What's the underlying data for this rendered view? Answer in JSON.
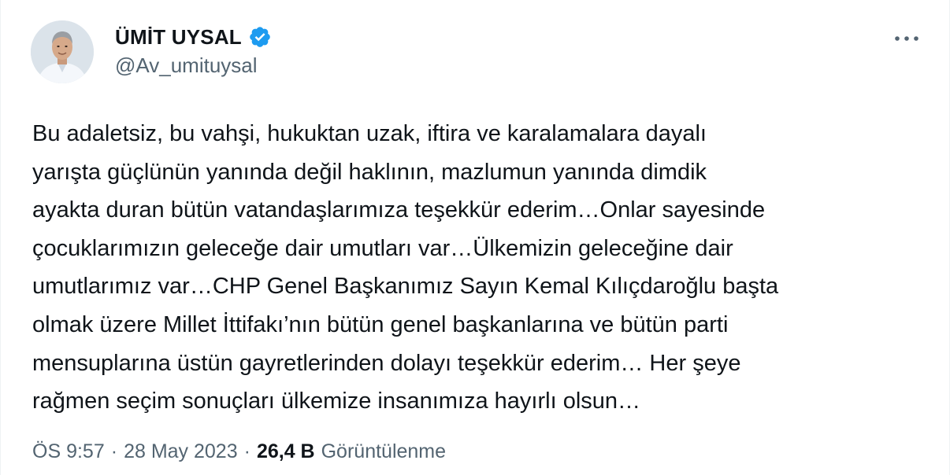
{
  "author": {
    "display_name": "ÜMİT UYSAL",
    "handle": "@Av_umituysal",
    "verified": true,
    "verified_icon": "verified-badge-icon",
    "verified_color": "#1d9bf0"
  },
  "tweet": {
    "lines": [
      "Bu adaletsiz, bu vahşi, hukuktan uzak, iftira ve karalamalara dayalı",
      "yarışta güçlünün yanında değil haklının, mazlumun yanında dimdik",
      "ayakta duran bütün vatandaşlarımıza teşekkür ederim…Onlar sayesinde",
      "çocuklarımızın geleceğe dair umutları var…Ülkemizin geleceğine dair",
      "umutlarımız var…CHP Genel Başkanımız Sayın Kemal Kılıçdaroğlu başta",
      "olmak üzere Millet İttifakı’nın bütün genel başkanlarına ve bütün parti",
      "mensuplarına üstün gayretlerinden dolayı teşekkür ederim… Her şeye",
      "rağmen seçim sonuçları ülkemize insanımıza hayırlı olsun…"
    ]
  },
  "meta": {
    "time": "ÖS 9:57",
    "separator": "·",
    "date": "28 May 2023",
    "views_count": "26,4 B",
    "views_label": "Görüntülenme"
  },
  "icons": {
    "more": "more-options-icon",
    "avatar": "avatar"
  },
  "colors": {
    "text_primary": "#0f1419",
    "text_secondary": "#536471",
    "accent": "#1d9bf0"
  }
}
